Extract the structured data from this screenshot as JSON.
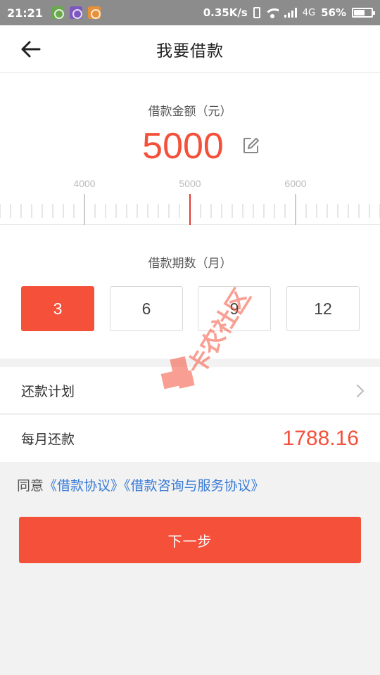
{
  "status_bar": {
    "time": "21:21",
    "speed": "0.35K/s",
    "network": "4G",
    "battery": "56%",
    "battery_level": 0.56,
    "notification_icons": [
      "wechat-icon",
      "chat-icon",
      "search-app-icon"
    ]
  },
  "header": {
    "title": "我要借款",
    "back_icon": "arrow-left-icon"
  },
  "amount": {
    "label": "借款金额（元）",
    "value": "5000",
    "edit_icon": "edit-icon",
    "ruler_labels": [
      "4000",
      "5000",
      "6000"
    ]
  },
  "term": {
    "label": "借款期数（月）",
    "options": [
      "3",
      "6",
      "9",
      "12"
    ],
    "selected": "3"
  },
  "plan": {
    "label": "还款计划"
  },
  "monthly": {
    "label": "每月还款",
    "value": "1788.16"
  },
  "agreement": {
    "prefix": "同意",
    "link1": "《借款协议》",
    "link2": "《借款咨询与服务协议》"
  },
  "next_button": {
    "label": "下一步"
  },
  "watermark": {
    "text": "卡农社区"
  },
  "colors": {
    "accent": "#f4503a",
    "link": "#3a7bd5",
    "status_bar": "#8c8c8c",
    "background": "#f2f2f2"
  }
}
